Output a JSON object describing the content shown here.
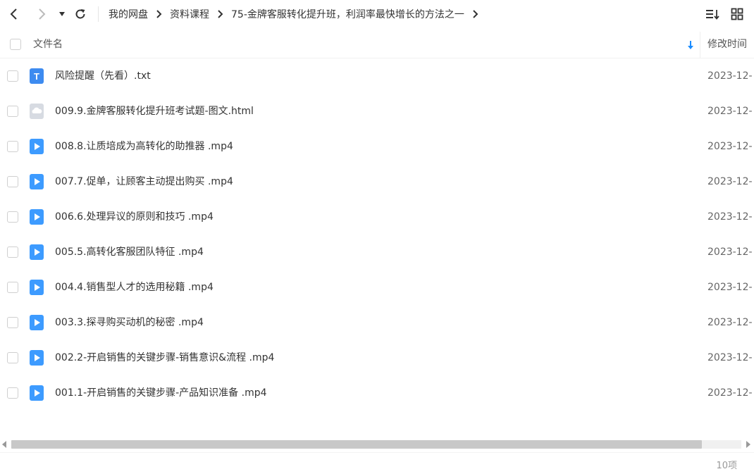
{
  "toolbar": {
    "back_icon": "chevron-left-icon",
    "forward_icon": "chevron-right-icon",
    "history_icon": "caret-down-icon",
    "refresh_icon": "refresh-icon",
    "sort_icon": "sort-list-icon",
    "grid_icon": "grid-view-icon"
  },
  "breadcrumb": [
    {
      "label": "我的网盘"
    },
    {
      "label": "资料课程"
    },
    {
      "label": "75-金牌客服转化提升班，利润率最快增长的方法之一"
    }
  ],
  "header": {
    "name_label": "文件名",
    "time_label": "修改时间",
    "sort_color": "#1a8cff"
  },
  "files": [
    {
      "name": "风险提醒（先看）.txt",
      "time": "2023-12-",
      "type": "txt"
    },
    {
      "name": "009.9.金牌客服转化提升班考试题-图文.html",
      "time": "2023-12-",
      "type": "html"
    },
    {
      "name": "008.8.让质培成为高转化的助推器 .mp4",
      "time": "2023-12-",
      "type": "video"
    },
    {
      "name": "007.7.促单，让顾客主动提出购买 .mp4",
      "time": "2023-12-",
      "type": "video"
    },
    {
      "name": "006.6.处理异议的原则和技巧 .mp4",
      "time": "2023-12-",
      "type": "video"
    },
    {
      "name": "005.5.高转化客服团队特征 .mp4",
      "time": "2023-12-",
      "type": "video"
    },
    {
      "name": "004.4.销售型人才的选用秘籍 .mp4",
      "time": "2023-12-",
      "type": "video"
    },
    {
      "name": "003.3.探寻购买动机的秘密 .mp4",
      "time": "2023-12-",
      "type": "video"
    },
    {
      "name": "002.2-开启销售的关键步骤-销售意识&流程 .mp4",
      "time": "2023-12-",
      "type": "video"
    },
    {
      "name": "001.1-开启销售的关键步骤-产品知识准备 .mp4",
      "time": "2023-12-",
      "type": "video"
    }
  ],
  "footer": {
    "count": "10项"
  },
  "colors": {
    "video_icon": "#3d9bff",
    "txt_icon": "#3d8bf0",
    "html_icon": "#d7dbe2"
  }
}
